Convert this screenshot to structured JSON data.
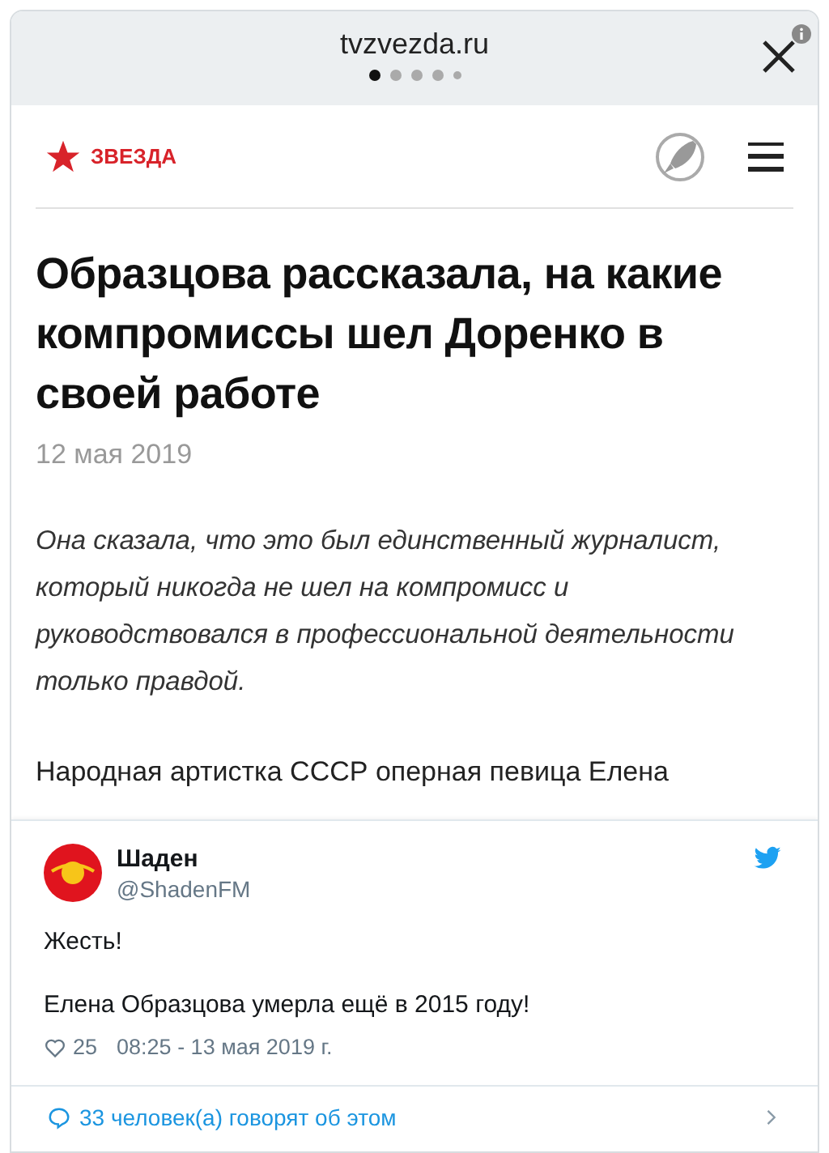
{
  "header": {
    "domain": "tvzvezda.ru",
    "dots": [
      {
        "selected": true
      },
      {
        "selected": false
      },
      {
        "selected": false
      },
      {
        "selected": false
      },
      {
        "selected": false
      }
    ]
  },
  "site": {
    "logo_text": "ЗВЕЗДА"
  },
  "article": {
    "title": "Образцова рассказала, на какие компромиссы шел Доренко в своей работе",
    "date": "12 мая 2019",
    "lead": "Она сказала, что это был единственный журналист, который никогда не шел на компромисс и руководствовался в профессиональной деятельности только правдой.",
    "paragraph": "Народная артистка СССР оперная певица Елена"
  },
  "tweet": {
    "name": "Шаден",
    "handle": "@ShadenFM",
    "lines": [
      "Жесть!",
      "Елена Образцова умерла ещё в 2015 году!"
    ],
    "likes": "25",
    "time": "08:25 - 13 мая 2019 г.",
    "discussion": "33 человек(а) говорят об этом"
  }
}
